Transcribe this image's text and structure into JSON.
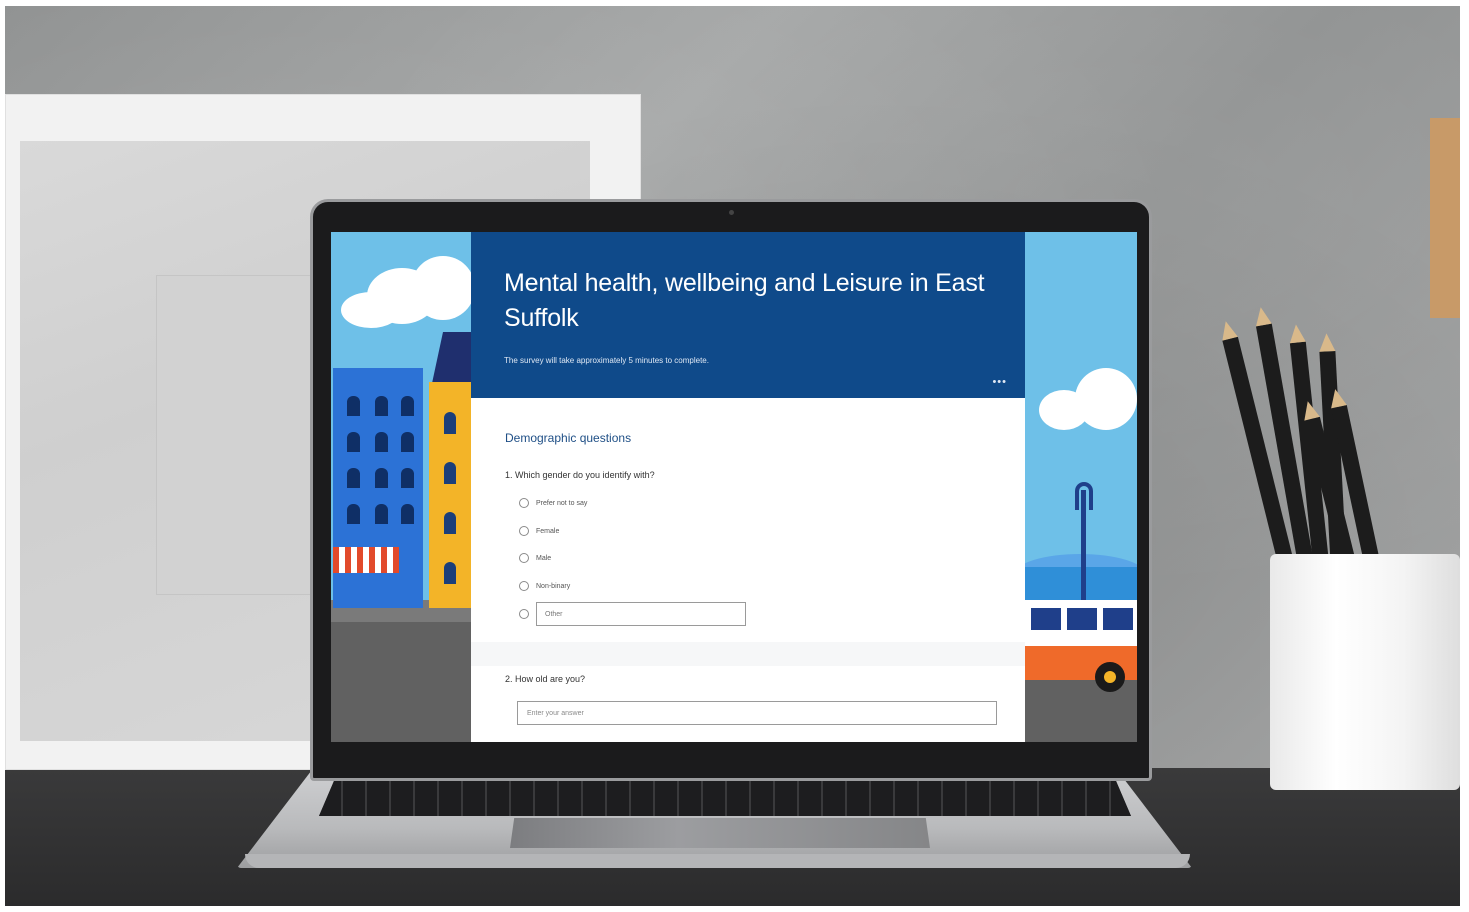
{
  "survey": {
    "title": "Mental health, wellbeing and Leisure in East Suffolk",
    "subtitle": "The survey will take approximately 5 minutes to complete.",
    "more_label": "•••"
  },
  "section": {
    "title": "Demographic questions"
  },
  "questions": [
    {
      "title": "1. Which gender do you identify with?",
      "options": [
        "Prefer not to say",
        "Female",
        "Male",
        "Non-binary"
      ],
      "other_placeholder": "Other"
    },
    {
      "title": "2. How old are you?",
      "answer_placeholder": "Enter your answer"
    }
  ],
  "colors": {
    "header_bg": "#0f4a8a",
    "accent_text": "#1f4f86",
    "sky": "#6ec0e8"
  }
}
